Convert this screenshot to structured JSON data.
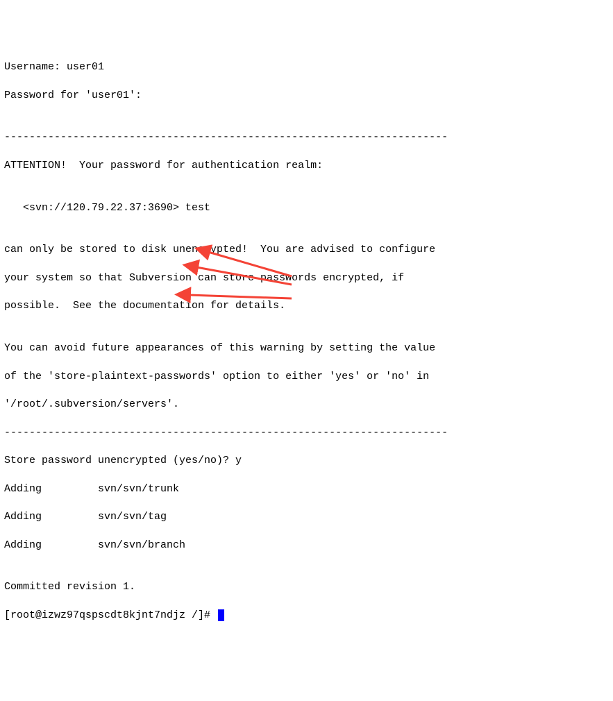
{
  "lines": {
    "l0": "Username: user01",
    "l1": "Password for 'user01':",
    "l2": "",
    "l3": "-----------------------------------------------------------------------",
    "l4": "ATTENTION!  Your password for authentication realm:",
    "l5": "",
    "l6": "   <svn://120.79.22.37:3690> test",
    "l7": "",
    "l8": "can only be stored to disk unencrypted!  You are advised to configure",
    "l9": "your system so that Subversion can store passwords encrypted, if",
    "l10": "possible.  See the documentation for details.",
    "l11": "",
    "l12": "You can avoid future appearances of this warning by setting the value",
    "l13": "of the 'store-plaintext-passwords' option to either 'yes' or 'no' in",
    "l14": "'/root/.subversion/servers'.",
    "l15": "-----------------------------------------------------------------------",
    "l16": "Store password unencrypted (yes/no)? y",
    "l17": "Adding         svn/svn/trunk",
    "l18": "Adding         svn/svn/tag",
    "l19": "Adding         svn/svn/branch",
    "l20": "",
    "l21": "Committed revision 1.",
    "l22": "[root@izwz97qspscdt8kjnt7ndjz /]# "
  },
  "annotation": {
    "color": "#f44336"
  }
}
